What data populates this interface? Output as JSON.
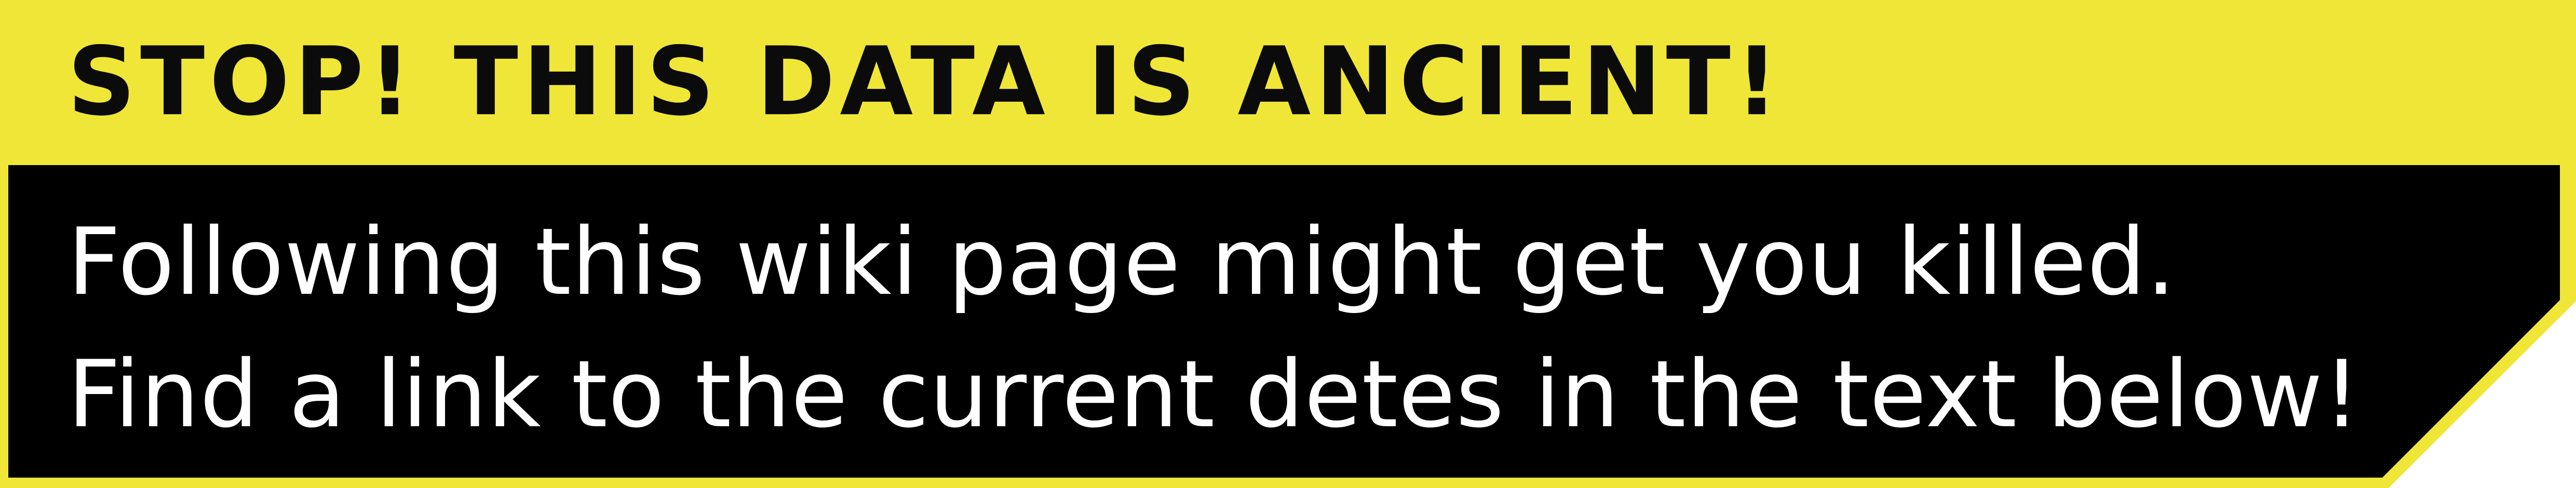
{
  "banner": {
    "heading": "STOP! THIS DATA IS ANCIENT!",
    "line_1": "Following this wiki page might get you killed.",
    "line_2": "Find a link to the current detes in the text below!"
  },
  "colors": {
    "accent_yellow": "#f0e637",
    "panel_black": "#000000",
    "text_white": "#ffffff"
  }
}
